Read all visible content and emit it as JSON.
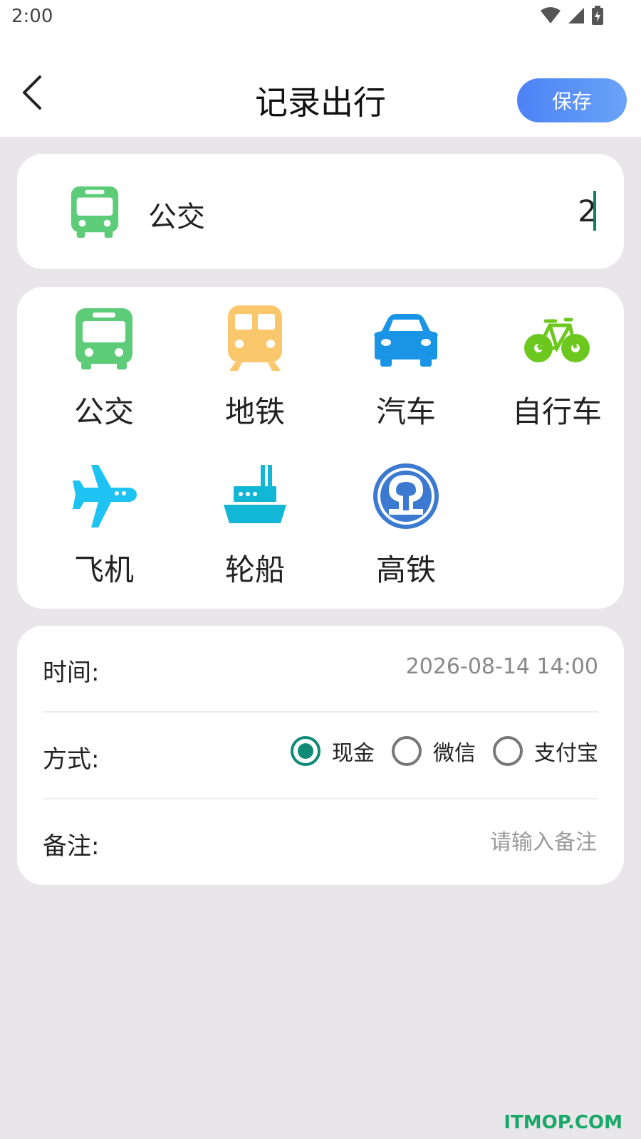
{
  "status": {
    "time": "2:00"
  },
  "header": {
    "title": "记录出行",
    "save_label": "保存"
  },
  "selected": {
    "label": "公交",
    "amount": "2",
    "icon": "bus-icon"
  },
  "modes": [
    {
      "label": "公交",
      "icon": "bus-icon",
      "color": "#5ccc79"
    },
    {
      "label": "地铁",
      "icon": "subway-icon",
      "color": "#fbc76d"
    },
    {
      "label": "汽车",
      "icon": "car-icon",
      "color": "#1a95e6"
    },
    {
      "label": "自行车",
      "icon": "bicycle-icon",
      "color": "#6cc81f"
    },
    {
      "label": "飞机",
      "icon": "airplane-icon",
      "color": "#1ec3f3"
    },
    {
      "label": "轮船",
      "icon": "ship-icon",
      "color": "#12b7d6"
    },
    {
      "label": "高铁",
      "icon": "high-speed-rail-icon",
      "color": "#3b7ad0"
    }
  ],
  "form": {
    "time_label": "时间:",
    "time_value": "2026-08-14 14:00",
    "method_label": "方式:",
    "methods": [
      {
        "label": "现金",
        "checked": true
      },
      {
        "label": "微信",
        "checked": false
      },
      {
        "label": "支付宝",
        "checked": false
      }
    ],
    "note_label": "备注:",
    "note_placeholder": "请输入备注",
    "note_value": ""
  },
  "watermark": "ITMOP.COM"
}
